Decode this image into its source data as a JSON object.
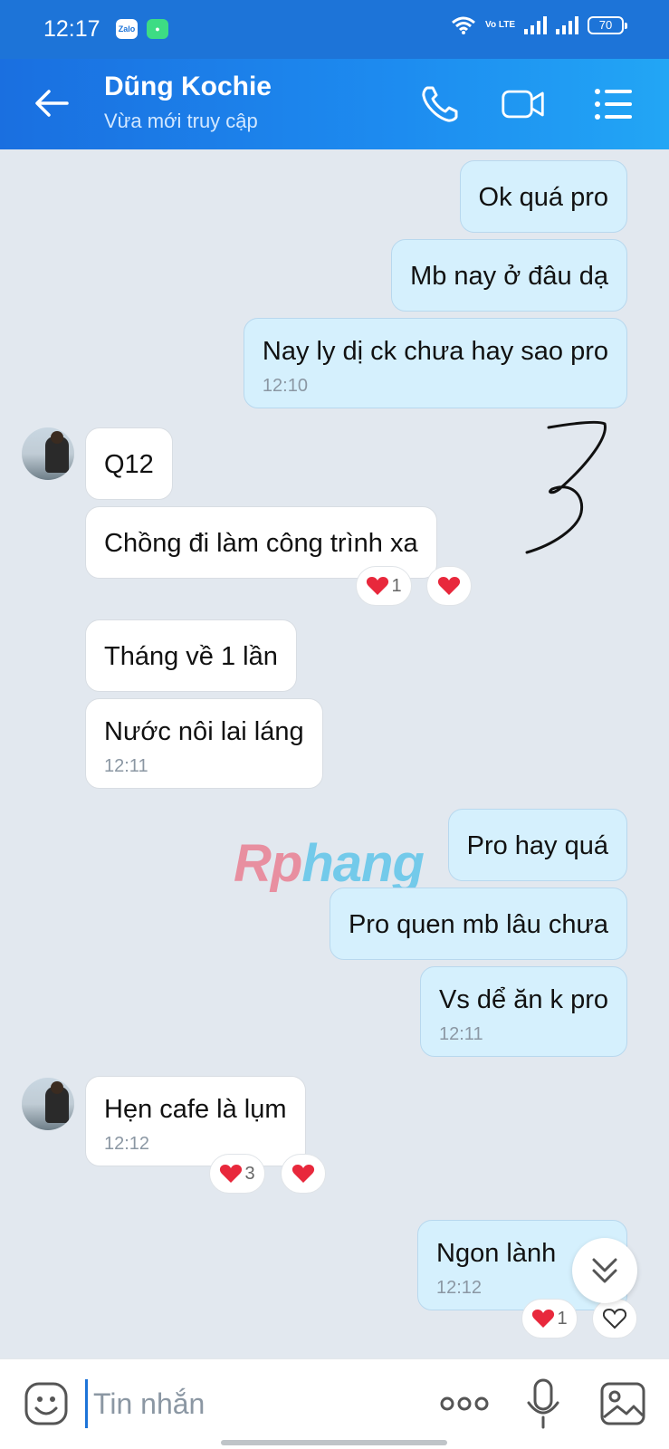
{
  "status_bar": {
    "time": "12:17",
    "app_badge_1": "Zalo",
    "battery": "70",
    "network": "Vo LTE"
  },
  "header": {
    "contact_name": "Dũng Kochie",
    "contact_status": "Vừa mới truy cập",
    "icons": [
      "back-arrow-icon",
      "phone-icon",
      "video-call-icon",
      "menu-list-icon"
    ]
  },
  "messages": [
    {
      "side": "out",
      "text": "Ok quá pro"
    },
    {
      "side": "out",
      "text": "Mb nay ở đâu dạ"
    },
    {
      "side": "out",
      "text": "Nay ly dị ck chưa hay sao pro",
      "time": "12:10"
    },
    {
      "side": "in",
      "text": "Q12"
    },
    {
      "side": "in",
      "text": "Chồng đi làm công trình xa",
      "reaction_count": "1"
    },
    {
      "side": "in",
      "text": "Tháng về 1 lần"
    },
    {
      "side": "in",
      "text": "Nước nôi lai láng",
      "time": "12:11"
    },
    {
      "side": "out",
      "text": "Pro hay quá"
    },
    {
      "side": "out",
      "text": "Pro quen mb lâu chưa"
    },
    {
      "side": "out",
      "text": "Vs dể ăn k pro",
      "time": "12:11"
    },
    {
      "side": "in",
      "text": "Hẹn cafe là lụm",
      "time": "12:12",
      "reaction_count": "3"
    },
    {
      "side": "out",
      "text": "Ngon lành",
      "time": "12:12",
      "reaction_count": "1"
    }
  ],
  "watermark": {
    "part1": "Rp",
    "part2": "hang"
  },
  "input": {
    "placeholder": "Tin nhắn"
  },
  "colors": {
    "header": "#1d74d8",
    "out_bubble": "#d5f0fd",
    "in_bubble": "#ffffff",
    "background": "#e2e8ef",
    "heart": "#e8283c"
  }
}
